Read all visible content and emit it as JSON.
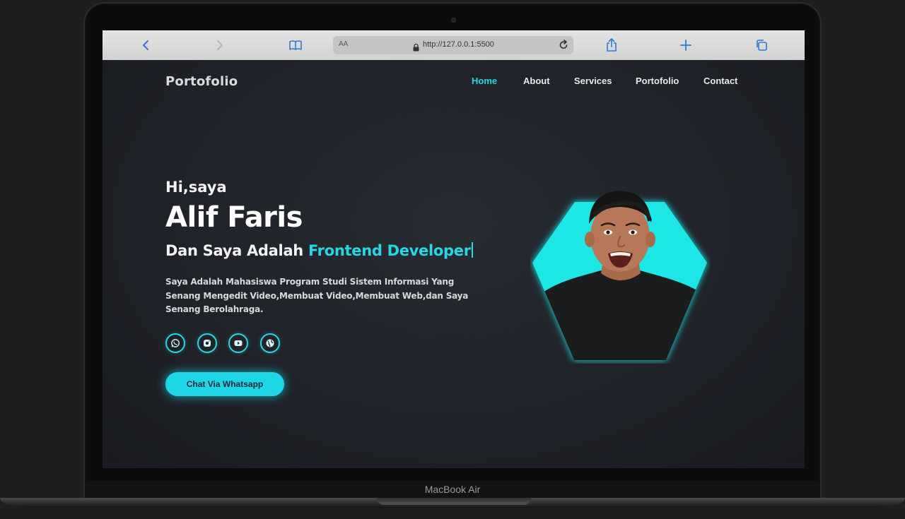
{
  "device": {
    "brand_label": "MacBook Air"
  },
  "browser": {
    "text_size_label": "AA",
    "url": "http://127.0.0.1:5500",
    "icons": [
      "back-icon",
      "forward-icon",
      "reader-icon",
      "lock-icon",
      "reload-icon",
      "share-icon",
      "new-tab-icon",
      "tabs-icon"
    ]
  },
  "site": {
    "logo": "Portofolio",
    "nav": [
      {
        "label": "Home",
        "active": true
      },
      {
        "label": "About",
        "active": false
      },
      {
        "label": "Services",
        "active": false
      },
      {
        "label": "Portofolio",
        "active": false
      },
      {
        "label": "Contact",
        "active": false
      }
    ],
    "hero": {
      "greeting": "Hi,saya",
      "name": "Alif Faris",
      "role_prefix": "Dan Saya Adalah ",
      "role_highlight": "Frontend Developer",
      "description": "Saya Adalah Mahasiswa Program Studi Sistem Informasi Yang Senang Mengedit Video,Membuat Video,Membuat Web,dan Saya Senang Berolahraga.",
      "socials": [
        "whatsapp-icon",
        "instagram-icon",
        "youtube-icon",
        "globe-icon"
      ],
      "cta_label": "Chat Via Whatsapp"
    }
  },
  "colors": {
    "accent": "#27d8e3",
    "background": "#1f2228",
    "browser_bar": "#d6d6d6"
  }
}
